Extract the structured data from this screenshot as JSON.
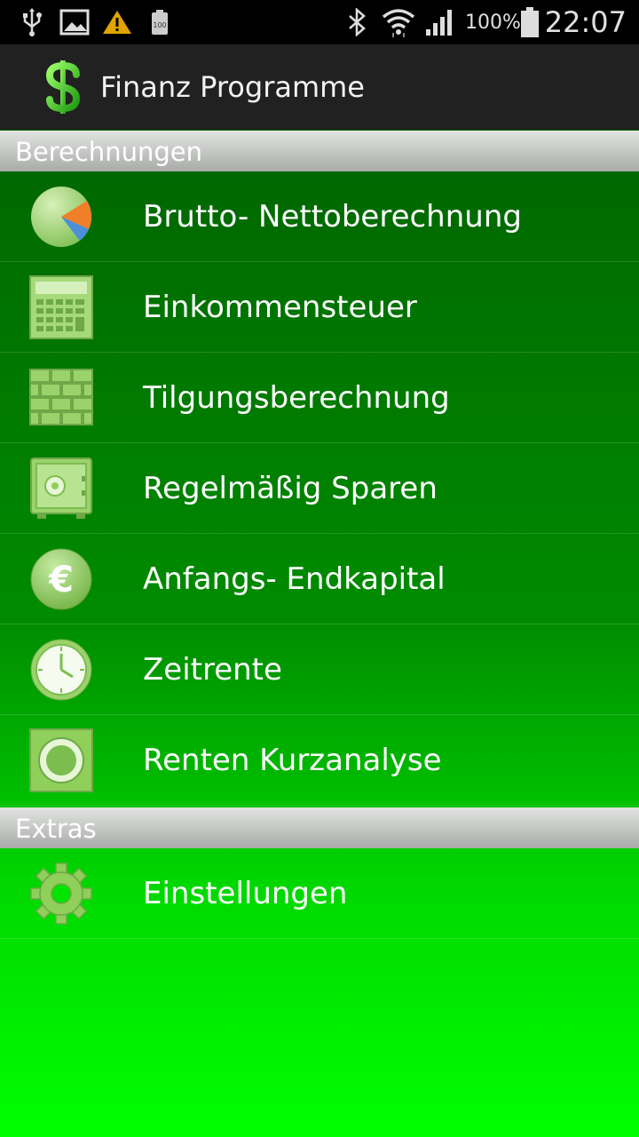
{
  "status_bar": {
    "battery_percent": "100%",
    "time": "22:07",
    "icons": [
      "usb-icon",
      "image-icon",
      "warning-icon",
      "battery-small-icon",
      "bluetooth-icon",
      "wifi-icon",
      "signal-icon",
      "battery-icon"
    ]
  },
  "action_bar": {
    "title": "Finanz Programme",
    "logo_icon": "dollar-icon"
  },
  "sections": [
    {
      "header": "Berechnungen",
      "items": [
        {
          "label": "Brutto- Nettoberechnung",
          "icon": "pie-chart-icon"
        },
        {
          "label": "Einkommensteuer",
          "icon": "calculator-icon"
        },
        {
          "label": "Tilgungsberechnung",
          "icon": "brick-wall-icon"
        },
        {
          "label": "Regelmäßig Sparen",
          "icon": "safe-icon"
        },
        {
          "label": "Anfangs- Endkapital",
          "icon": "euro-icon"
        },
        {
          "label": "Zeitrente",
          "icon": "clock-icon"
        },
        {
          "label": "Renten Kurzanalyse",
          "icon": "target-icon"
        }
      ]
    },
    {
      "header": "Extras",
      "items": [
        {
          "label": "Einstellungen",
          "icon": "gear-icon"
        }
      ]
    }
  ],
  "colors": {
    "status_bar": "#000000",
    "action_bar": "#212121",
    "list_top": "#005a00",
    "list_bottom": "#00ff00",
    "icon_green": "#8fcf5a"
  }
}
